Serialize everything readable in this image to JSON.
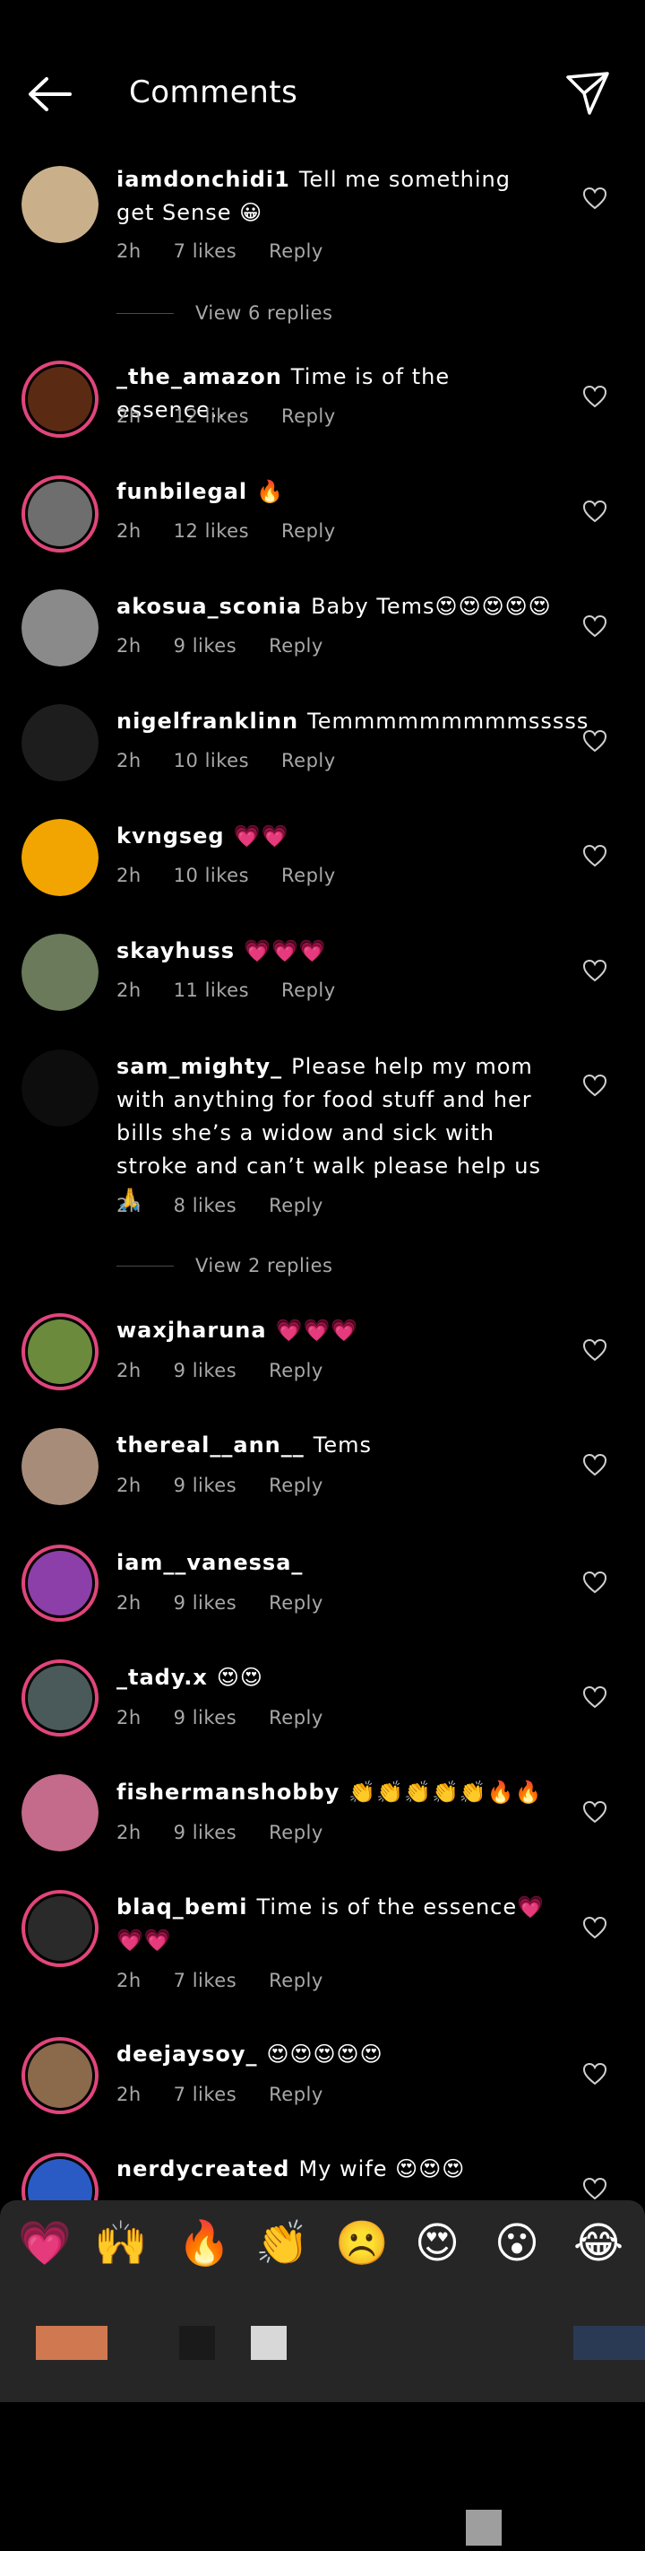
{
  "header": {
    "title": "Comments"
  },
  "comments": [
    {
      "username": "iamdonchidi1",
      "text": "Tell me something get Sense 😀",
      "time": "2h",
      "likes": "7 likes",
      "reply": "Reply",
      "replies": "View 6 replies",
      "avatar_color": "#c9b08b",
      "ring": false
    },
    {
      "username": "_the_amazon",
      "text": "Time is of the essence...",
      "time": "2h",
      "likes": "12 likes",
      "reply": "Reply",
      "avatar_color": "#5a2b12",
      "ring": true
    },
    {
      "username": "funbilegal",
      "text": "🔥",
      "time": "2h",
      "likes": "12 likes",
      "reply": "Reply",
      "avatar_color": "#6e6e6e",
      "ring": true
    },
    {
      "username": "akosua_sconia",
      "text": "Baby Tems😍😍😍😍😍",
      "time": "2h",
      "likes": "9 likes",
      "reply": "Reply",
      "avatar_color": "#8a8a8a",
      "ring": false
    },
    {
      "username": "nigelfranklinn",
      "text": "Temmmmmmmmmsssss",
      "time": "2h",
      "likes": "10 likes",
      "reply": "Reply",
      "avatar_color": "#1d1d1d",
      "ring": false
    },
    {
      "username": "kvngseg",
      "text": "💗💗",
      "time": "2h",
      "likes": "10 likes",
      "reply": "Reply",
      "avatar_color": "#f2a400",
      "ring": false
    },
    {
      "username": "skayhuss",
      "text": "💗💗💗",
      "time": "2h",
      "likes": "11 likes",
      "reply": "Reply",
      "avatar_color": "#6a7a5a",
      "ring": false
    },
    {
      "username": "sam_mighty_",
      "text": "Please help my mom with anything for food stuff and her bills she’s a widow and sick with stroke and can’t walk please help us 🙏",
      "time": "2h",
      "likes": "8 likes",
      "reply": "Reply",
      "replies": "View 2 replies",
      "avatar_color": "#0d0d0d",
      "ring": false
    },
    {
      "username": "waxjharuna",
      "text": "💗💗💗",
      "time": "2h",
      "likes": "9 likes",
      "reply": "Reply",
      "avatar_color": "#6b8a3c",
      "ring": true
    },
    {
      "username": "thereal__ann__",
      "text": "Tems",
      "time": "2h",
      "likes": "9 likes",
      "reply": "Reply",
      "avatar_color": "#a88c7a",
      "ring": false
    },
    {
      "username": "iam__vanessa_",
      "text": "",
      "time": "2h",
      "likes": "9 likes",
      "reply": "Reply",
      "avatar_color": "#8c3fa8",
      "ring": true
    },
    {
      "username": "_tady.x",
      "text": "😍😍",
      "time": "2h",
      "likes": "9 likes",
      "reply": "Reply",
      "avatar_color": "#4a5a5a",
      "ring": true
    },
    {
      "username": "fishermanshobby",
      "text": "👏👏👏👏👏🔥🔥",
      "time": "2h",
      "likes": "9 likes",
      "reply": "Reply",
      "avatar_color": "#c46a8a",
      "ring": false
    },
    {
      "username": "blaq_bemi",
      "text": "Time is of the essence💗💗💗",
      "time": "2h",
      "likes": "7 likes",
      "reply": "Reply",
      "avatar_color": "#2a2a2a",
      "ring": true
    },
    {
      "username": "deejaysoy_",
      "text": "😍😍😍😍😍",
      "time": "2h",
      "likes": "7 likes",
      "reply": "Reply",
      "avatar_color": "#8a6a4a",
      "ring": true
    },
    {
      "username": "nerdycreated",
      "text": "My wife 😍😍😍",
      "time": "",
      "likes": "",
      "reply": "",
      "avatar_color": "#2a5ac4",
      "ring": true
    }
  ],
  "emoji_bar": [
    "💗",
    "🙌",
    "🔥",
    "👏",
    "☹️",
    "😍",
    "😮",
    "😂"
  ]
}
